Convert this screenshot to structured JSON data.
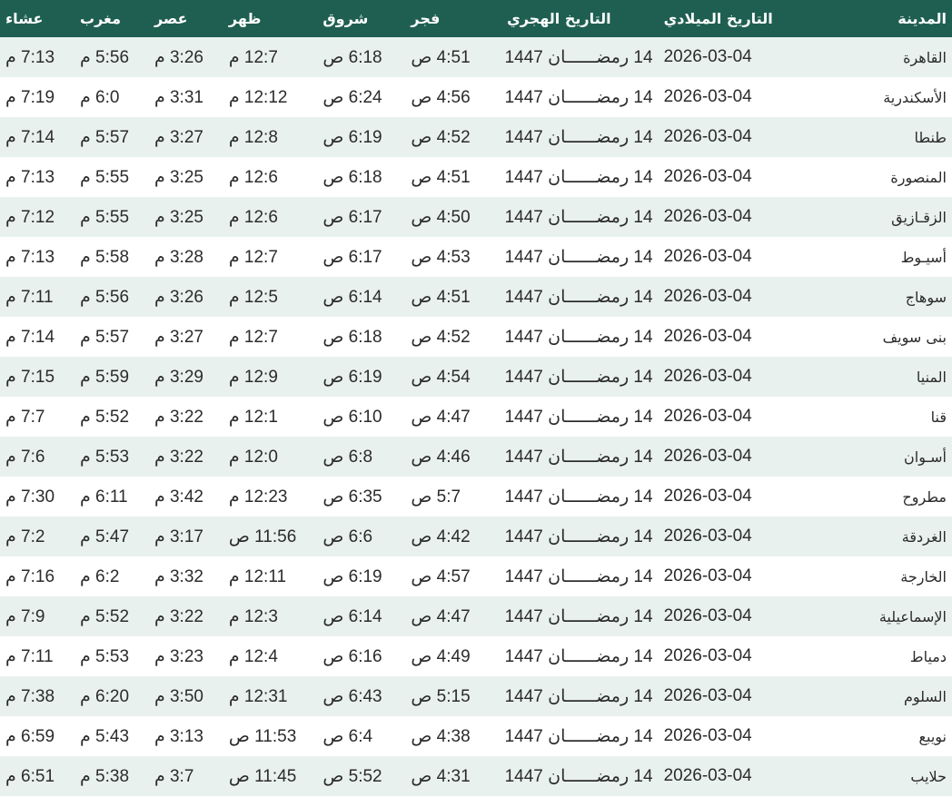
{
  "table": {
    "headers": [
      "المدينة",
      "التاريخ الميلادي",
      "التاريخ الهجري",
      "فجر",
      "شروق",
      "ظهر",
      "عصر",
      "مغرب",
      "عشاء"
    ],
    "rows": [
      [
        "القاهرة",
        "2026-03-04",
        "14 رمضــــــان 1447",
        "4:51 ص",
        "6:18 ص",
        "12:7 م",
        "3:26 م",
        "5:56 م",
        "7:13 م"
      ],
      [
        "الأسكندرية",
        "2026-03-04",
        "14 رمضــــــان 1447",
        "4:56 ص",
        "6:24 ص",
        "12:12 م",
        "3:31 م",
        "6:0 م",
        "7:19 م"
      ],
      [
        "طنطا",
        "2026-03-04",
        "14 رمضــــــان 1447",
        "4:52 ص",
        "6:19 ص",
        "12:8 م",
        "3:27 م",
        "5:57 م",
        "7:14 م"
      ],
      [
        "المنصورة",
        "2026-03-04",
        "14 رمضــــــان 1447",
        "4:51 ص",
        "6:18 ص",
        "12:6 م",
        "3:25 م",
        "5:55 م",
        "7:13 م"
      ],
      [
        "الزقـازيق",
        "2026-03-04",
        "14 رمضــــــان 1447",
        "4:50 ص",
        "6:17 ص",
        "12:6 م",
        "3:25 م",
        "5:55 م",
        "7:12 م"
      ],
      [
        "أسيـوط",
        "2026-03-04",
        "14 رمضــــــان 1447",
        "4:53 ص",
        "6:17 ص",
        "12:7 م",
        "3:28 م",
        "5:58 م",
        "7:13 م"
      ],
      [
        "سوهاج",
        "2026-03-04",
        "14 رمضــــــان 1447",
        "4:51 ص",
        "6:14 ص",
        "12:5 م",
        "3:26 م",
        "5:56 م",
        "7:11 م"
      ],
      [
        "بنى سويف",
        "2026-03-04",
        "14 رمضــــــان 1447",
        "4:52 ص",
        "6:18 ص",
        "12:7 م",
        "3:27 م",
        "5:57 م",
        "7:14 م"
      ],
      [
        "المنيا",
        "2026-03-04",
        "14 رمضــــــان 1447",
        "4:54 ص",
        "6:19 ص",
        "12:9 م",
        "3:29 م",
        "5:59 م",
        "7:15 م"
      ],
      [
        "قنا",
        "2026-03-04",
        "14 رمضــــــان 1447",
        "4:47 ص",
        "6:10 ص",
        "12:1 م",
        "3:22 م",
        "5:52 م",
        "7:7 م"
      ],
      [
        "أسـوان",
        "2026-03-04",
        "14 رمضــــــان 1447",
        "4:46 ص",
        "6:8 ص",
        "12:0 م",
        "3:22 م",
        "5:53 م",
        "7:6 م"
      ],
      [
        "مطروح",
        "2026-03-04",
        "14 رمضــــــان 1447",
        "5:7 ص",
        "6:35 ص",
        "12:23 م",
        "3:42 م",
        "6:11 م",
        "7:30 م"
      ],
      [
        "الغردقة",
        "2026-03-04",
        "14 رمضــــــان 1447",
        "4:42 ص",
        "6:6 ص",
        "11:56 ص",
        "3:17 م",
        "5:47 م",
        "7:2 م"
      ],
      [
        "الخارجة",
        "2026-03-04",
        "14 رمضــــــان 1447",
        "4:57 ص",
        "6:19 ص",
        "12:11 م",
        "3:32 م",
        "6:2 م",
        "7:16 م"
      ],
      [
        "الإسماعيلية",
        "2026-03-04",
        "14 رمضــــــان 1447",
        "4:47 ص",
        "6:14 ص",
        "12:3 م",
        "3:22 م",
        "5:52 م",
        "7:9 م"
      ],
      [
        "دمياط",
        "2026-03-04",
        "14 رمضــــــان 1447",
        "4:49 ص",
        "6:16 ص",
        "12:4 م",
        "3:23 م",
        "5:53 م",
        "7:11 م"
      ],
      [
        "السلوم",
        "2026-03-04",
        "14 رمضــــــان 1447",
        "5:15 ص",
        "6:43 ص",
        "12:31 م",
        "3:50 م",
        "6:20 م",
        "7:38 م"
      ],
      [
        "نويبع",
        "2026-03-04",
        "14 رمضــــــان 1447",
        "4:38 ص",
        "6:4 ص",
        "11:53 ص",
        "3:13 م",
        "5:43 م",
        "6:59 م"
      ],
      [
        "حلايب",
        "2026-03-04",
        "14 رمضــــــان 1447",
        "4:31 ص",
        "5:52 ص",
        "11:45 ص",
        "3:7 م",
        "5:38 م",
        "6:51 م"
      ]
    ]
  },
  "colors": {
    "header_bg": "#1f5f52",
    "header_text": "#ffffff",
    "row_odd": "#e9f1ef",
    "row_even": "#ffffff"
  }
}
